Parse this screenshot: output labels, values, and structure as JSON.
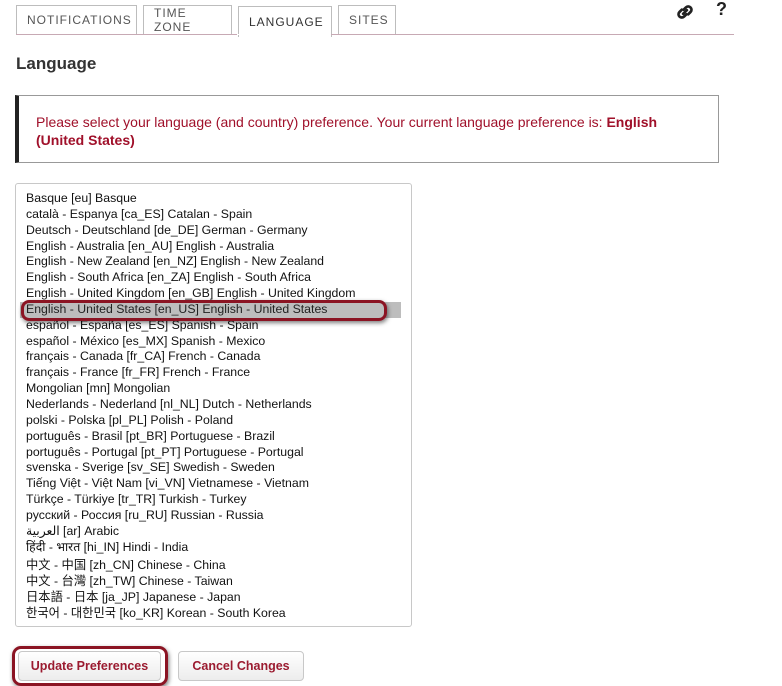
{
  "tabs": [
    {
      "label": "NOTIFICATIONS"
    },
    {
      "label": "TIME ZONE"
    },
    {
      "label": "LANGUAGE"
    },
    {
      "label": "SITES"
    }
  ],
  "header_icons": {
    "link": "link-icon",
    "help": "?"
  },
  "page": {
    "title": "Language"
  },
  "notice": {
    "text": "Please select your language (and country) preference. Your current language preference is: ",
    "current": "English (United States)"
  },
  "languages": {
    "selected_index": 7,
    "options": [
      "Basque [eu] Basque",
      "català - Espanya [ca_ES] Catalan - Spain",
      "Deutsch - Deutschland [de_DE] German - Germany",
      "English - Australia [en_AU] English - Australia",
      "English - New Zealand [en_NZ] English - New Zealand",
      "English - South Africa [en_ZA] English - South Africa",
      "English - United Kingdom [en_GB] English - United Kingdom",
      "English - United States [en_US] English - United States",
      "español - España [es_ES] Spanish - Spain",
      "español - México [es_MX] Spanish - Mexico",
      "français - Canada [fr_CA] French - Canada",
      "français - France [fr_FR] French - France",
      "Mongolian [mn] Mongolian",
      "Nederlands - Nederland [nl_NL] Dutch - Netherlands",
      "polski - Polska [pl_PL] Polish - Poland",
      "português - Brasil [pt_BR] Portuguese - Brazil",
      "português - Portugal [pt_PT] Portuguese - Portugal",
      "svenska - Sverige [sv_SE] Swedish - Sweden",
      "Tiếng Việt - Việt Nam [vi_VN] Vietnamese - Vietnam",
      "Türkçe - Türkiye [tr_TR] Turkish - Turkey",
      "русский - Россия [ru_RU] Russian - Russia",
      "العربية [ar] Arabic",
      "हिंदी - भारत [hi_IN] Hindi - India",
      "中文 - 中国 [zh_CN] Chinese - China",
      "中文 - 台灣 [zh_TW] Chinese - Taiwan",
      "日本語 - 日本 [ja_JP] Japanese - Japan",
      "한국어 - 대한민국 [ko_KR] Korean - South Korea"
    ]
  },
  "buttons": {
    "update": "Update Preferences",
    "cancel": "Cancel Changes"
  }
}
